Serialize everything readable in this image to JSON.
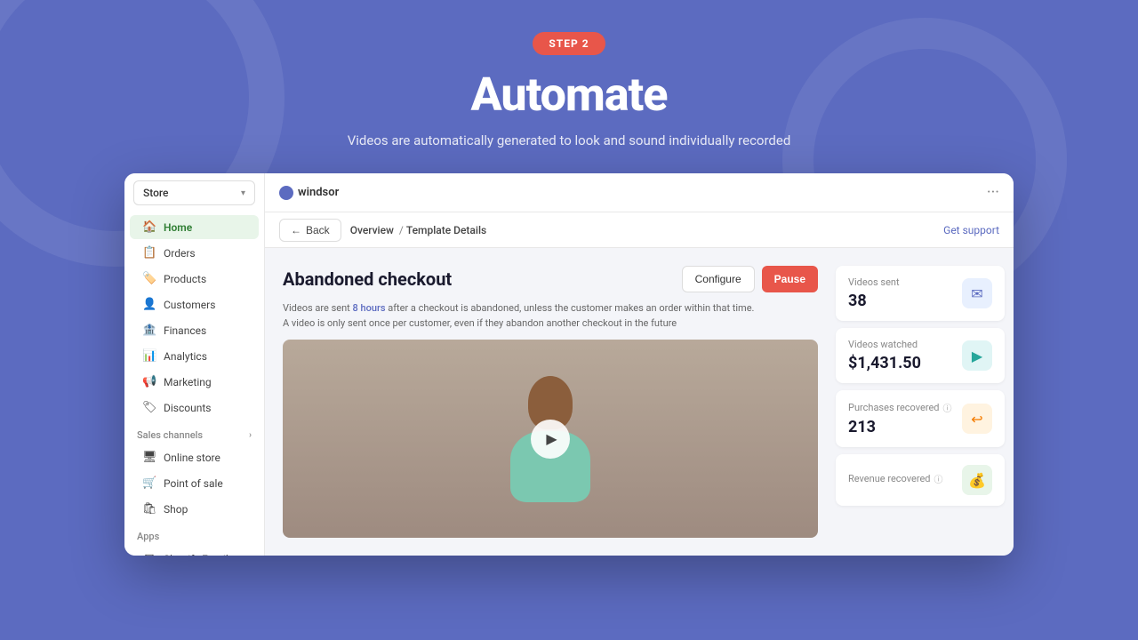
{
  "background_color": "#5c6bc0",
  "step_badge": {
    "label": "STEP 2"
  },
  "header": {
    "title": "Automate",
    "subtitle": "Videos are automatically generated to look and sound individually recorded"
  },
  "window": {
    "topbar": {
      "logo_name": "windsor",
      "menu_icon": "···"
    },
    "breadcrumb": {
      "back_label": "Back",
      "overview_label": "Overview",
      "current_label": "Template Details",
      "get_support_label": "Get support"
    },
    "sidebar": {
      "store_selector": {
        "label": "Store",
        "icon": "chevron-down"
      },
      "nav_items": [
        {
          "label": "Home",
          "icon": "🏠",
          "active": true
        },
        {
          "label": "Orders",
          "icon": "📋",
          "active": false
        },
        {
          "label": "Products",
          "icon": "🏷️",
          "active": false
        },
        {
          "label": "Customers",
          "icon": "👤",
          "active": false
        },
        {
          "label": "Finances",
          "icon": "🏦",
          "active": false
        },
        {
          "label": "Analytics",
          "icon": "📊",
          "active": false
        },
        {
          "label": "Marketing",
          "icon": "📢",
          "active": false
        },
        {
          "label": "Discounts",
          "icon": "🏷",
          "active": false
        }
      ],
      "sales_channels": {
        "section_label": "Sales channels",
        "items": [
          {
            "label": "Online store",
            "icon": "🖥"
          },
          {
            "label": "Point of sale",
            "icon": "🛒"
          },
          {
            "label": "Shop",
            "icon": "🛍"
          }
        ]
      },
      "apps": {
        "section_label": "Apps",
        "items": [
          {
            "label": "Shopify Email",
            "icon": "✉"
          }
        ]
      }
    },
    "main": {
      "page_title": "Abandoned checkout",
      "configure_btn": "Configure",
      "pause_btn": "Pause",
      "description_line1": "Videos are sent 8 hours after a checkout is abandoned, unless the customer makes an order within that time.",
      "description_line2": "A video is only sent once per customer, even if they abandon another checkout in the future",
      "highlight_text": "8 hours",
      "stats": [
        {
          "label": "Videos sent",
          "value": "38",
          "icon": "✉",
          "icon_style": "blue"
        },
        {
          "label": "Videos watched",
          "value": "$1,431.50",
          "icon": "▶",
          "icon_style": "teal"
        },
        {
          "label": "Purchases recovered",
          "value": "213",
          "icon": "↩",
          "icon_style": "orange",
          "has_info": true
        },
        {
          "label": "Revenue recovered",
          "value": "",
          "icon": "💰",
          "icon_style": "green",
          "has_info": true
        }
      ]
    }
  }
}
